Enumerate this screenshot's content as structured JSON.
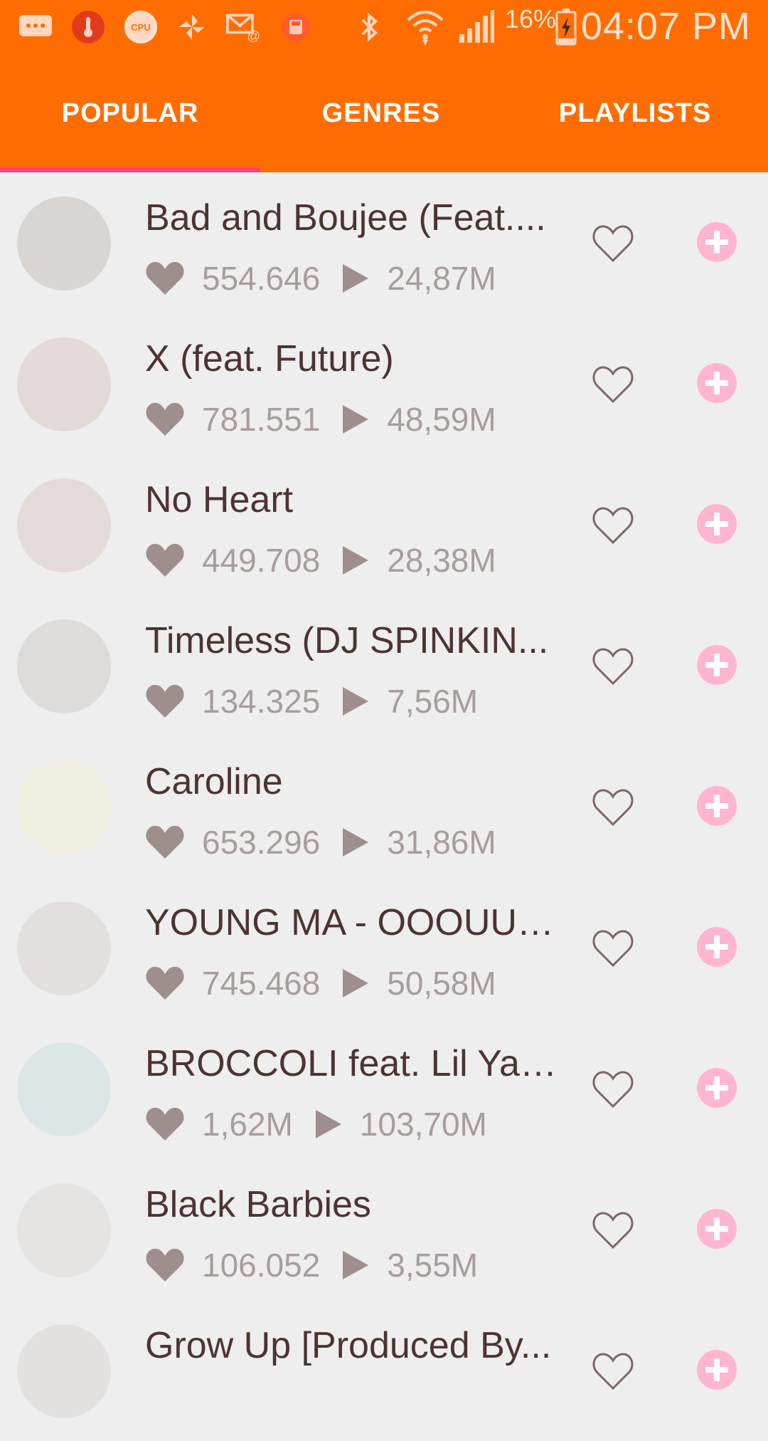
{
  "status_bar": {
    "battery": "16%",
    "time": "04:07 PM"
  },
  "tabs": [
    {
      "label": "POPULAR",
      "active": true
    },
    {
      "label": "GENRES",
      "active": false
    },
    {
      "label": "PLAYLISTS",
      "active": false
    }
  ],
  "colors": {
    "accent": "#ff6d00",
    "indicator": "#ff3d7f",
    "add_button": "#ffb5cf"
  },
  "songs": [
    {
      "title": "Bad and Boujee (Feat....",
      "likes": "554.646",
      "plays": "24,87M",
      "thumb": "#d9d5d3"
    },
    {
      "title": "X (feat. Future)",
      "likes": "781.551",
      "plays": "48,59M",
      "thumb": "#e3d9d9"
    },
    {
      "title": "No Heart",
      "likes": "449.708",
      "plays": "28,38M",
      "thumb": "#e5dada"
    },
    {
      "title": "Timeless (DJ SPINKIN...",
      "likes": "134.325",
      "plays": "7,56M",
      "thumb": "#dedbdb"
    },
    {
      "title": "Caroline",
      "likes": "653.296",
      "plays": "31,86M",
      "thumb": "#f1efe2"
    },
    {
      "title": "YOUNG MA - OOOUUU...",
      "likes": "745.468",
      "plays": "50,58M",
      "thumb": "#e3dfdf"
    },
    {
      "title": "BROCCOLI feat. Lil Yac...",
      "likes": "1,62M",
      "plays": "103,70M",
      "thumb": "#dde6e6"
    },
    {
      "title": "Black Barbies",
      "likes": "106.052",
      "plays": "3,55M",
      "thumb": "#e6e3e3"
    },
    {
      "title": "Grow Up [Produced By...",
      "likes": "",
      "plays": "",
      "thumb": "#e3e0e0"
    }
  ]
}
